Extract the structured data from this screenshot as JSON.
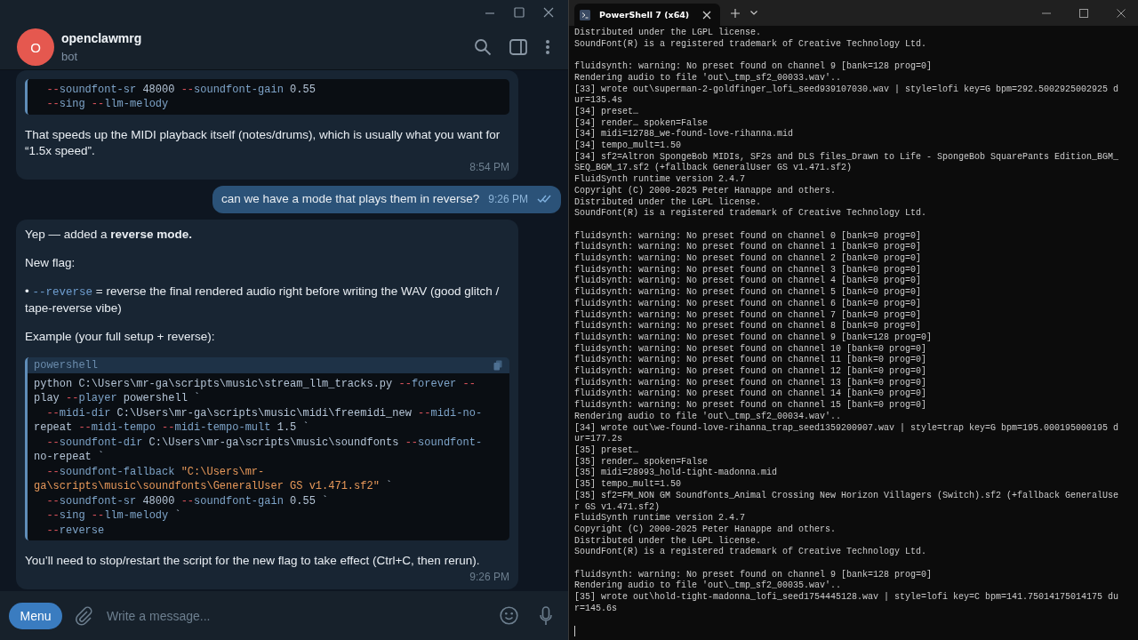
{
  "chat_window": {
    "contact": {
      "name": "openclawmrg",
      "status": "bot",
      "avatar_letter": "O"
    },
    "messages": [
      {
        "kind": "bot",
        "time": "8:54 PM",
        "blocks": [
          {
            "kind": "code",
            "lines": [
              {
                "indent": true,
                "tokens": [
                  {
                    "kind": "op",
                    "text": "--"
                  },
                  {
                    "kind": "flag",
                    "text": "soundfont-sr"
                  },
                  {
                    "kind": "text",
                    "text": " 48000 "
                  },
                  {
                    "kind": "op",
                    "text": "--"
                  },
                  {
                    "kind": "flag",
                    "text": "soundfont-gain"
                  },
                  {
                    "kind": "text",
                    "text": " 0.55"
                  }
                ]
              },
              {
                "indent": true,
                "tokens": [
                  {
                    "kind": "op",
                    "text": "--"
                  },
                  {
                    "kind": "flag",
                    "text": "sing "
                  },
                  {
                    "kind": "op",
                    "text": "--"
                  },
                  {
                    "kind": "flag",
                    "text": "llm-melody"
                  }
                ]
              }
            ]
          },
          {
            "kind": "text",
            "text": "That speeds up the MIDI playback itself (notes/drums), which is usually what you want for “1.5x speed”."
          }
        ]
      },
      {
        "kind": "user",
        "text": "can we have a mode that plays them in reverse?",
        "time": "9:26 PM",
        "read": true
      },
      {
        "kind": "bot",
        "time": "9:26 PM",
        "blocks": [
          {
            "kind": "text",
            "text": "Yep — added a **reverse mode.**"
          },
          {
            "kind": "text",
            "text": "New flag:"
          },
          {
            "kind": "bullet",
            "marker": "•",
            "code": "--reverse",
            "text": "= reverse the final rendered audio right before writing the WAV (good glitch / tape-reverse vibe)"
          },
          {
            "kind": "text",
            "text": "Example (your full setup + reverse):"
          },
          {
            "kind": "code",
            "lang": "powershell",
            "lines": [
              {
                "indent": false,
                "tokens": [
                  {
                    "kind": "text",
                    "text": "python C:\\Users\\mr-ga\\scripts\\music\\stream_llm_tracks.py "
                  },
                  {
                    "kind": "op",
                    "text": "--"
                  },
                  {
                    "kind": "flag",
                    "text": "forever "
                  },
                  {
                    "kind": "op",
                    "text": "--"
                  }
                ]
              },
              {
                "indent": false,
                "tokens": [
                  {
                    "kind": "text",
                    "text": "play "
                  },
                  {
                    "kind": "op",
                    "text": "--"
                  },
                  {
                    "kind": "flag",
                    "text": "player"
                  },
                  {
                    "kind": "text",
                    "text": " powershell `"
                  }
                ]
              },
              {
                "indent": true,
                "tokens": [
                  {
                    "kind": "op",
                    "text": "--"
                  },
                  {
                    "kind": "flag",
                    "text": "midi-dir"
                  },
                  {
                    "kind": "text",
                    "text": " C:\\Users\\mr-ga\\scripts\\music\\midi\\freemidi_new "
                  },
                  {
                    "kind": "op",
                    "text": "--"
                  },
                  {
                    "kind": "flag",
                    "text": "midi-no-"
                  }
                ]
              },
              {
                "indent": false,
                "tokens": [
                  {
                    "kind": "text",
                    "text": "repeat "
                  },
                  {
                    "kind": "op",
                    "text": "--"
                  },
                  {
                    "kind": "flag",
                    "text": "midi-tempo "
                  },
                  {
                    "kind": "op",
                    "text": "--"
                  },
                  {
                    "kind": "flag",
                    "text": "midi-tempo-mult"
                  },
                  {
                    "kind": "text",
                    "text": " 1.5 `"
                  }
                ]
              },
              {
                "indent": true,
                "tokens": [
                  {
                    "kind": "op",
                    "text": "--"
                  },
                  {
                    "kind": "flag",
                    "text": "soundfont-dir"
                  },
                  {
                    "kind": "text",
                    "text": " C:\\Users\\mr-ga\\scripts\\music\\soundfonts "
                  },
                  {
                    "kind": "op",
                    "text": "--"
                  },
                  {
                    "kind": "flag",
                    "text": "soundfont-"
                  }
                ]
              },
              {
                "indent": false,
                "tokens": [
                  {
                    "kind": "text",
                    "text": "no-repeat `"
                  }
                ]
              },
              {
                "indent": true,
                "tokens": [
                  {
                    "kind": "op",
                    "text": "--"
                  },
                  {
                    "kind": "flag",
                    "text": "soundfont-fallback "
                  },
                  {
                    "kind": "str",
                    "text": "\"C:\\Users\\mr-"
                  }
                ]
              },
              {
                "indent": false,
                "tokens": [
                  {
                    "kind": "str",
                    "text": "ga\\scripts\\music\\soundfonts\\GeneralUser GS v1.471.sf2\""
                  },
                  {
                    "kind": "text",
                    "text": " `"
                  }
                ]
              },
              {
                "indent": true,
                "tokens": [
                  {
                    "kind": "op",
                    "text": "--"
                  },
                  {
                    "kind": "flag",
                    "text": "soundfont-sr"
                  },
                  {
                    "kind": "text",
                    "text": " 48000 "
                  },
                  {
                    "kind": "op",
                    "text": "--"
                  },
                  {
                    "kind": "flag",
                    "text": "soundfont-gain"
                  },
                  {
                    "kind": "text",
                    "text": " 0.55 `"
                  }
                ]
              },
              {
                "indent": true,
                "tokens": [
                  {
                    "kind": "op",
                    "text": "--"
                  },
                  {
                    "kind": "flag",
                    "text": "sing "
                  },
                  {
                    "kind": "op",
                    "text": "--"
                  },
                  {
                    "kind": "flag",
                    "text": "llm-melody"
                  },
                  {
                    "kind": "text",
                    "text": " `"
                  }
                ]
              },
              {
                "indent": true,
                "tokens": [
                  {
                    "kind": "op",
                    "text": "--"
                  },
                  {
                    "kind": "flag",
                    "text": "reverse"
                  }
                ]
              }
            ]
          },
          {
            "kind": "text",
            "text": "You’ll need to stop/restart the script for the new flag to take effect (Ctrl+C, then rerun)."
          }
        ]
      }
    ],
    "composer": {
      "menu_button": "Menu",
      "placeholder": "Write a message..."
    }
  },
  "terminal": {
    "tab": {
      "title": "PowerShell 7 (x64)"
    },
    "output": [
      [
        "Distributed under the LGPL license.",
        "SoundFont(R) is a registered trademark of Creative Technology Ltd."
      ],
      [
        "fluidsynth: warning: No preset found on channel 9 [bank=128 prog=0]",
        "Rendering audio to file 'out\\_tmp_sf2_00033.wav'..",
        "[33] wrote out\\superman-2-goldfinger_lofi_seed939107030.wav | style=lofi key=G bpm=292.5002925002925 d",
        "ur=135.4s",
        "[34] preset…",
        "[34] render… spoken=False",
        "[34] midi=12788_we-found-love-rihanna.mid",
        "[34] tempo_mult=1.50",
        "[34] sf2=Altron SpongeBob MIDIs, SF2s and DLS files_Drawn to Life - SpongeBob SquarePants Edition_BGM_",
        "SEQ_BGM_17.sf2 (+fallback GeneralUser GS v1.471.sf2)",
        "FluidSynth runtime version 2.4.7",
        "Copyright (C) 2000-2025 Peter Hanappe and others.",
        "Distributed under the LGPL license.",
        "SoundFont(R) is a registered trademark of Creative Technology Ltd."
      ],
      [
        "fluidsynth: warning: No preset found on channel 0 [bank=0 prog=0]",
        "fluidsynth: warning: No preset found on channel 1 [bank=0 prog=0]",
        "fluidsynth: warning: No preset found on channel 2 [bank=0 prog=0]",
        "fluidsynth: warning: No preset found on channel 3 [bank=0 prog=0]",
        "fluidsynth: warning: No preset found on channel 4 [bank=0 prog=0]",
        "fluidsynth: warning: No preset found on channel 5 [bank=0 prog=0]",
        "fluidsynth: warning: No preset found on channel 6 [bank=0 prog=0]",
        "fluidsynth: warning: No preset found on channel 7 [bank=0 prog=0]",
        "fluidsynth: warning: No preset found on channel 8 [bank=0 prog=0]",
        "fluidsynth: warning: No preset found on channel 9 [bank=128 prog=0]",
        "fluidsynth: warning: No preset found on channel 10 [bank=0 prog=0]",
        "fluidsynth: warning: No preset found on channel 11 [bank=0 prog=0]",
        "fluidsynth: warning: No preset found on channel 12 [bank=0 prog=0]",
        "fluidsynth: warning: No preset found on channel 13 [bank=0 prog=0]",
        "fluidsynth: warning: No preset found on channel 14 [bank=0 prog=0]",
        "fluidsynth: warning: No preset found on channel 15 [bank=0 prog=0]",
        "Rendering audio to file 'out\\_tmp_sf2_00034.wav'..",
        "[34] wrote out\\we-found-love-rihanna_trap_seed1359200907.wav | style=trap key=G bpm=195.000195000195 d",
        "ur=177.2s",
        "[35] preset…",
        "[35] render… spoken=False",
        "[35] midi=28993_hold-tight-madonna.mid",
        "[35] tempo_mult=1.50",
        "[35] sf2=FM_NON GM Soundfonts_Animal Crossing New Horizon Villagers (Switch).sf2 (+fallback GeneralUse",
        "r GS v1.471.sf2)",
        "FluidSynth runtime version 2.4.7",
        "Copyright (C) 2000-2025 Peter Hanappe and others.",
        "Distributed under the LGPL license.",
        "SoundFont(R) is a registered trademark of Creative Technology Ltd."
      ],
      [
        "fluidsynth: warning: No preset found on channel 9 [bank=128 prog=0]",
        "Rendering audio to file 'out\\_tmp_sf2_00035.wav'..",
        "[35] wrote out\\hold-tight-madonna_lofi_seed1754445128.wav | style=lofi key=C bpm=141.75014175014175 du",
        "r=145.6s"
      ]
    ]
  }
}
